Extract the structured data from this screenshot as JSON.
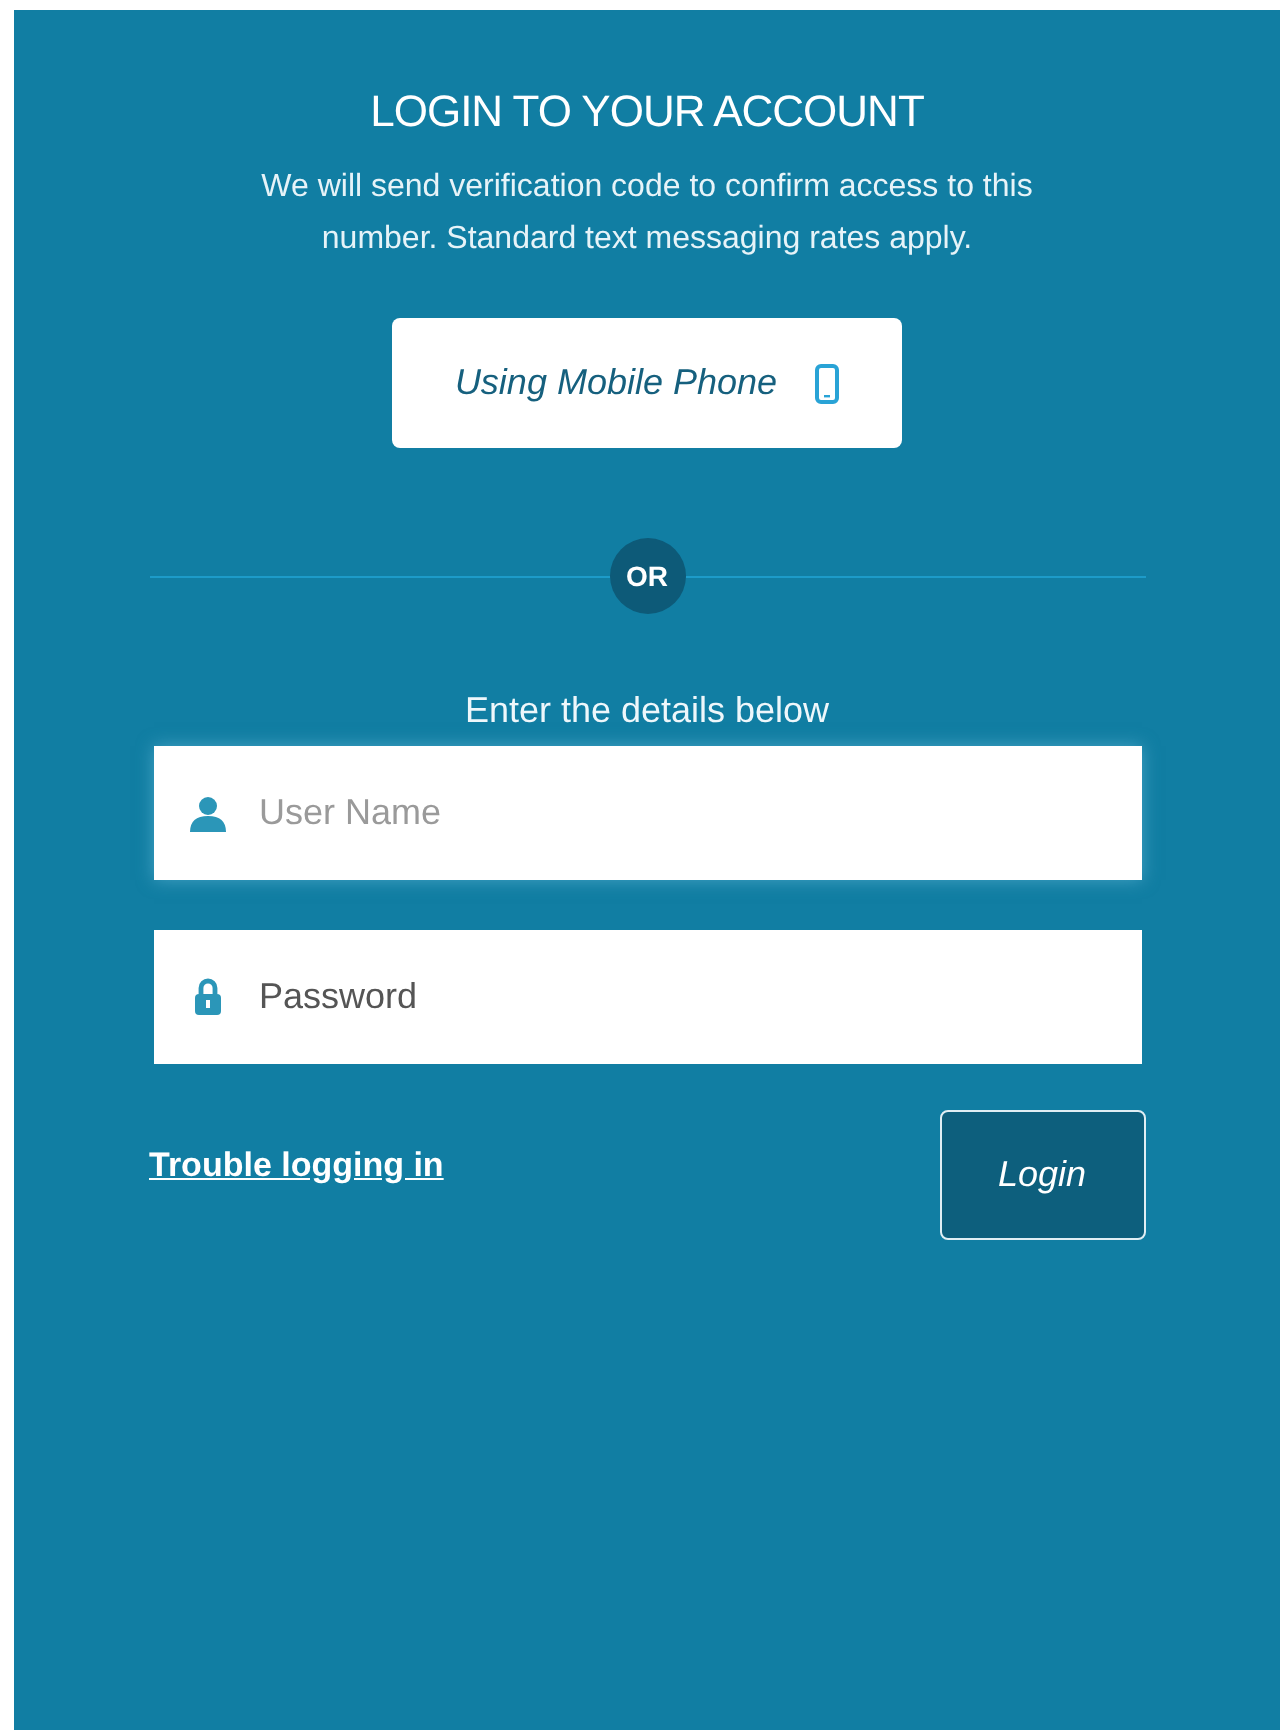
{
  "title": "LOGIN TO YOUR ACCOUNT",
  "description": "We will send verification code to confirm access to this number. Standard text messaging rates apply.",
  "phone_button": {
    "label": "Using Mobile Phone"
  },
  "divider": {
    "label": "OR"
  },
  "form": {
    "heading": "Enter the details below",
    "fields": [
      {
        "kind": "user",
        "placeholder": "User Name"
      },
      {
        "kind": "password",
        "placeholder": "Password"
      }
    ],
    "help_link": "Trouble logging in",
    "submit": "Login"
  }
}
